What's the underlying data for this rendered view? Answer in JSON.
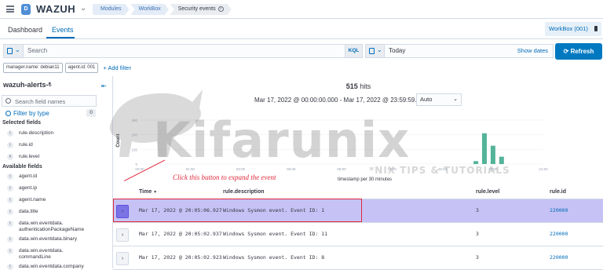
{
  "topbar": {
    "logo_letter": "D",
    "brand": "WAZUH",
    "breadcrumbs": [
      "Modules",
      "WorkBox",
      "Security events"
    ]
  },
  "tabs": [
    "Dashboard",
    "Events"
  ],
  "workbox_button": "WorkBox (001)",
  "search": {
    "placeholder": "Search",
    "language": "KQL"
  },
  "date": {
    "value": "Today",
    "show_dates": "Show dates"
  },
  "refresh_label": "Refresh",
  "filters": [
    "manager.name: debian11",
    "agent.id: 001"
  ],
  "add_filter": "+ Add filter",
  "sidebar": {
    "index_pattern": "wazuh-alerts-*",
    "field_search_placeholder": "Search field names",
    "filter_by_type": "Filter by type",
    "filter_count": "0",
    "selected_title": "Selected fields",
    "selected_fields": [
      {
        "type": "t",
        "name": "rule.description"
      },
      {
        "type": "t",
        "name": "rule.id"
      },
      {
        "type": "#",
        "name": "rule.level"
      }
    ],
    "available_title": "Available fields",
    "available_fields": [
      {
        "type": "t",
        "name": "agent.id"
      },
      {
        "type": "t",
        "name": "agent.ip"
      },
      {
        "type": "t",
        "name": "agent.name"
      },
      {
        "type": "t",
        "name": "data.title"
      },
      {
        "type": "t",
        "name": "data.win.eventdata.\nauthenticationPackageName"
      },
      {
        "type": "t",
        "name": "data.win.eventdata.binary"
      },
      {
        "type": "t",
        "name": "data.win.eventdata.\ncommandLine"
      },
      {
        "type": "t",
        "name": "data.win.eventdata.company"
      }
    ]
  },
  "hits": {
    "count": "515",
    "label": "hits"
  },
  "range_text": "Mar 17, 2022 @ 00:00:00.000 - Mar 17, 2022 @ 23:59:59.999",
  "interval": "Auto",
  "chart_data": {
    "type": "bar",
    "ylabel": "Count",
    "xlabel": "timestamp per 30 minutes",
    "x_ticks": [
      "00:00",
      "01:00",
      "03:00",
      "06:00",
      "09:00",
      "12:00",
      "15:00",
      "18:00",
      "21:00"
    ],
    "y_ticks": [
      "300",
      "200",
      "100",
      "0"
    ],
    "ylim": [
      0,
      300
    ],
    "categories": [
      "19:00",
      "19:30",
      "20:00",
      "20:30"
    ],
    "values": [
      20,
      210,
      125,
      50
    ],
    "bar_color": "#54b399"
  },
  "table": {
    "headers": [
      "Time",
      "rule.description",
      "rule.level",
      "rule.id"
    ],
    "rows": [
      {
        "time": "Mar 17, 2022 @ 20:05:06.927",
        "desc": "Windows Sysmon event. Event ID: 1",
        "level": "3",
        "id": "220000"
      },
      {
        "time": "Mar 17, 2022 @ 20:05:02.937",
        "desc": "Windows Sysmon event. Event ID: 11",
        "level": "3",
        "id": "220000"
      },
      {
        "time": "Mar 17, 2022 @ 20:05:02.923",
        "desc": "Windows Sysmon event. Event ID: 8",
        "level": "3",
        "id": "220000"
      }
    ]
  },
  "annotation": "Click this button to expand the event",
  "watermark": {
    "main": "Kifarunix",
    "sub": "*NIX TIPS & TUTORIALS"
  }
}
